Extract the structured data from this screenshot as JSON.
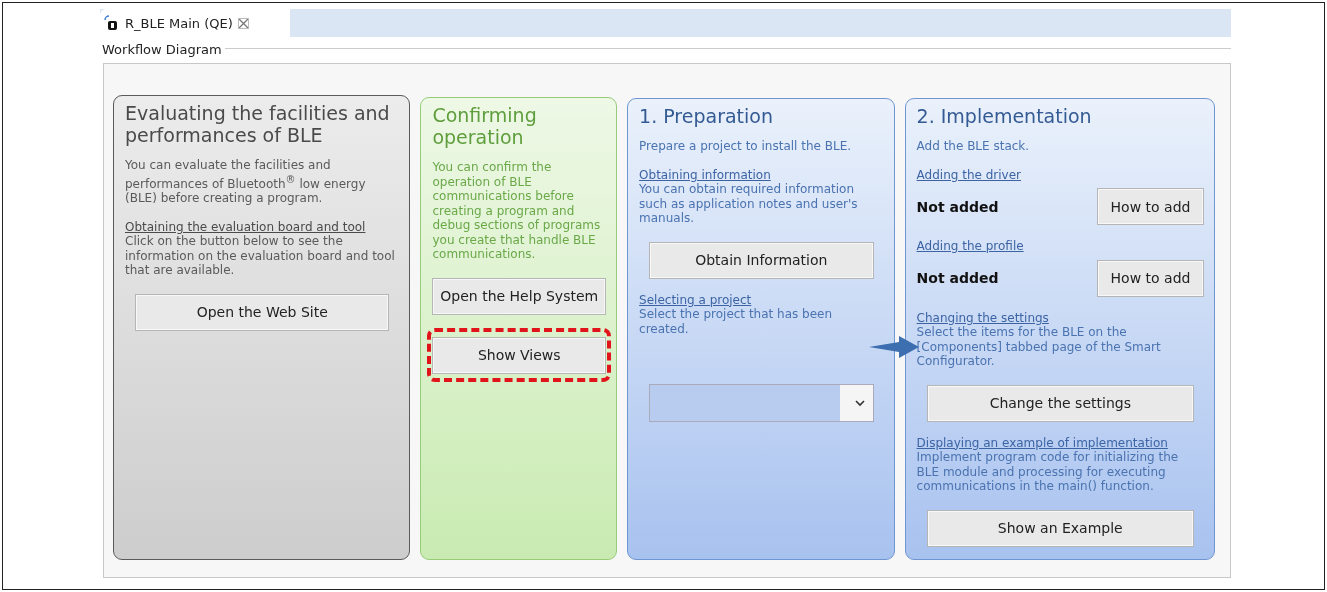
{
  "tab": {
    "title": "R_BLE Main (QE)",
    "selected": true
  },
  "group": {
    "title": "Workflow Diagram"
  },
  "panels": [
    {
      "kind": "gray",
      "title": "Evaluating the facilities and performances of BLE",
      "blocks": [
        {
          "kind": "intro",
          "text": "You can evaluate the facilities and performances of Bluetooth$^{®}$ low energy (BLE) before creating a program."
        },
        {
          "kind": "section",
          "heading": "Obtaining the evaluation board and tool",
          "body": "Click on the button below to see the information on the evaluation board and tool that are available."
        },
        {
          "kind": "button",
          "label": "Open the Web Site",
          "highlighted": false
        }
      ]
    },
    {
      "kind": "green",
      "title": "Confirming operation",
      "blocks": [
        {
          "kind": "intro",
          "text": "You can confirm the operation of BLE communications before creating a program and debug sections of programs you create that handle BLE communications."
        },
        {
          "kind": "button",
          "label": "Open the Help System",
          "highlighted": false
        },
        {
          "kind": "button",
          "label": "Show Views",
          "highlighted": true
        }
      ]
    },
    {
      "kind": "blue",
      "title": "1. Preparation",
      "blocks": [
        {
          "kind": "intro",
          "text": "Prepare a project to install the BLE."
        },
        {
          "kind": "section",
          "heading": "Obtaining information",
          "body": "You can obtain required information such as application notes and user's manuals."
        },
        {
          "kind": "button",
          "label": "Obtain Information",
          "highlighted": false
        },
        {
          "kind": "section",
          "heading": "Selecting a project",
          "body": "Select the project that has been created."
        },
        {
          "kind": "dropdown"
        }
      ]
    },
    {
      "kind": "blue",
      "title": "2. Implementation",
      "blocks": [
        {
          "kind": "intro",
          "text": "Add the BLE stack."
        },
        {
          "kind": "section",
          "heading": "Adding the driver"
        },
        {
          "kind": "status",
          "status": "Not added",
          "button": "How to add"
        },
        {
          "kind": "section",
          "heading": "Adding the profile"
        },
        {
          "kind": "status",
          "status": "Not added",
          "button": "How to add"
        },
        {
          "kind": "section",
          "heading": "Changing the settings",
          "body": "Select the items for the BLE on the [Components] tabbed page of the Smart Configurator."
        },
        {
          "kind": "button",
          "label": "Change the settings",
          "highlighted": false
        },
        {
          "kind": "section",
          "heading": "Displaying an example of implementation",
          "body": "Implement program code for initializing the BLE module and processing for executing communications in the main() function."
        },
        {
          "kind": "button",
          "label": "Show an Example",
          "highlighted": false
        }
      ]
    }
  ]
}
